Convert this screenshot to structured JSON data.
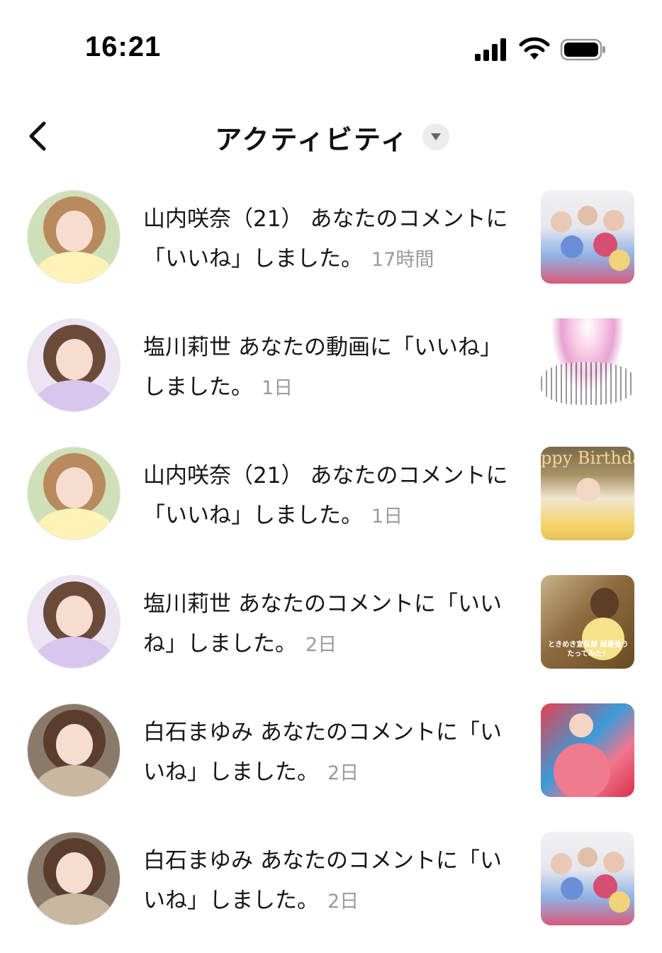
{
  "status_bar": {
    "time": "16:21",
    "icons": [
      "signal-icon",
      "wifi-icon",
      "battery-icon"
    ]
  },
  "header": {
    "title": "アクティビティ",
    "back_icon": "chevron-left-icon",
    "dropdown_icon": "caret-down-icon"
  },
  "activities": [
    {
      "user": "山内咲奈（21）",
      "message": "あなたのコメントに「いいね」しました。",
      "time": "17時間",
      "avatar": "avatar-yellow",
      "thumbnail": "thumb-group"
    },
    {
      "user": "塩川莉世",
      "message": "あなたの動画に「いいね」しました。",
      "time": "1日",
      "avatar": "avatar-lavender",
      "thumbnail": "thumb-burst"
    },
    {
      "user": "山内咲奈（21）",
      "message": "あなたのコメントに「いいね」しました。",
      "time": "1日",
      "avatar": "avatar-yellow",
      "thumbnail": "thumb-birthday",
      "thumbnail_text": "ppy Birthda"
    },
    {
      "user": "塩川莉世",
      "message": "あなたのコメントに「いいね」しました。",
      "time": "2日",
      "avatar": "avatar-lavender",
      "thumbnail": "thumb-promo",
      "thumbnail_text": "ときめき宣伝部 超最強うたってみた！"
    },
    {
      "user": "白石まゆみ",
      "message": "あなたのコメントに「いいね」しました。",
      "time": "2日",
      "avatar": "avatar-brown",
      "thumbnail": "thumb-stage"
    },
    {
      "user": "白石まゆみ",
      "message": "あなたのコメントに「いいね」しました。",
      "time": "2日",
      "avatar": "avatar-brown",
      "thumbnail": "thumb-group"
    }
  ],
  "colors": {
    "text": "#161616",
    "time_ago": "#9a9a9a",
    "background": "#ffffff"
  }
}
